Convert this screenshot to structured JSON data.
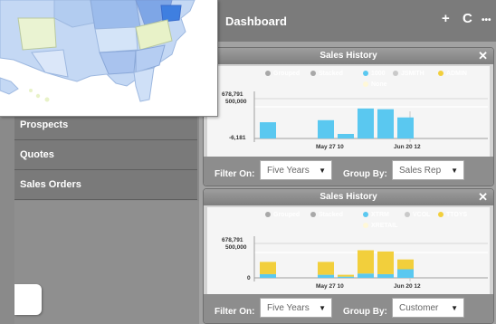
{
  "header": {
    "title": "Dashboard",
    "add_icon": "+",
    "refresh_icon": "C",
    "more_icon": "•••"
  },
  "nav": {
    "items": [
      {
        "label": "Prospects"
      },
      {
        "label": "Quotes"
      },
      {
        "label": "Sales Orders"
      }
    ]
  },
  "panels": [
    {
      "title": "Sales History",
      "legend": [
        "Grouped",
        "Stacked",
        "1000",
        "JSMITH",
        "ADMIN",
        "None"
      ],
      "filter_label": "Filter On:",
      "filter_value": "Five Years",
      "group_label": "Group By:",
      "group_value": "Sales Rep",
      "colors": {
        "blue": "#5ac8f0",
        "yellow": "#f2cf3c",
        "white": "#fff8d8",
        "grey": "#9a9a9a"
      }
    },
    {
      "title": "Sales History",
      "legend": [
        "Grouped",
        "Stacked",
        "XTRM",
        "VCOL",
        "TTOYS",
        "XRETAIL"
      ],
      "filter_label": "Filter On:",
      "filter_value": "Five Years",
      "group_label": "Group By:",
      "group_value": "Customer"
    }
  ],
  "chart_data": [
    {
      "type": "bar",
      "title": "Sales History",
      "series": [
        {
          "name": "1000",
          "values": [
            230000,
            0,
            260000,
            60000,
            430000,
            420000,
            300000
          ]
        }
      ],
      "y_tick_labels": [
        "678,791",
        "500,000",
        "-6,181"
      ],
      "x_tick_labels": [
        "May 27 10",
        "Jun 20 12"
      ],
      "ylim": [
        -6181,
        678791
      ]
    },
    {
      "type": "bar",
      "title": "Sales History",
      "series": [
        {
          "name": "XTRM",
          "values": [
            60000,
            0,
            50000,
            20000,
            70000,
            60000,
            140000
          ]
        },
        {
          "name": "TTOYS",
          "values": [
            200000,
            0,
            210000,
            30000,
            380000,
            370000,
            160000
          ]
        }
      ],
      "y_tick_labels": [
        "678,791",
        "500,000",
        "0"
      ],
      "x_tick_labels": [
        "May 27 10",
        "Jun 20 12"
      ],
      "ylim": [
        0,
        678791
      ]
    }
  ]
}
